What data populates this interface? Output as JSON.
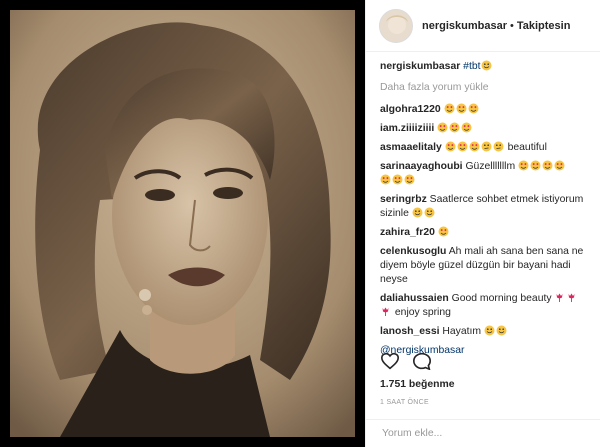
{
  "post": {
    "username": "nergiskumbasar",
    "follow_label": "Takiptesin",
    "separator": "•",
    "caption": {
      "user": "nergiskumbasar",
      "hashtag": "#tbt"
    },
    "load_more": "Daha fazla yorum yükle",
    "comments": [
      {
        "user": "algohra1220",
        "text": ""
      },
      {
        "user": "iam.ziiiiziiii",
        "text": ""
      },
      {
        "user": "asmaaelitaly",
        "text": "beautiful"
      },
      {
        "user": "sarinaayaghoubi",
        "text": "Güzelllllllm"
      },
      {
        "user": "seringrbz",
        "text": "Saatlerce sohbet etmek istiyorum sizinle"
      },
      {
        "user": "zahira_fr20",
        "text": ""
      },
      {
        "user": "celenkusoglu",
        "text": "Ah mali ah sana ben sana ne diyem böyle güzel düzgün bir bayani hadi neyse"
      },
      {
        "user": "daliahussaien",
        "text": "Good morning beauty"
      },
      {
        "user": "",
        "text": "enjoy spring"
      },
      {
        "user": "lanosh_essi",
        "text": "Hayatım"
      }
    ],
    "mention": "@nergiskumbasar",
    "likes": "1.751 beğenme",
    "time": "1 SAAT ÖNCE",
    "comment_placeholder": "Yorum ekle...",
    "colors": {
      "link": "#003569",
      "muted": "#999999",
      "text": "#262626",
      "border": "#efefef"
    }
  }
}
